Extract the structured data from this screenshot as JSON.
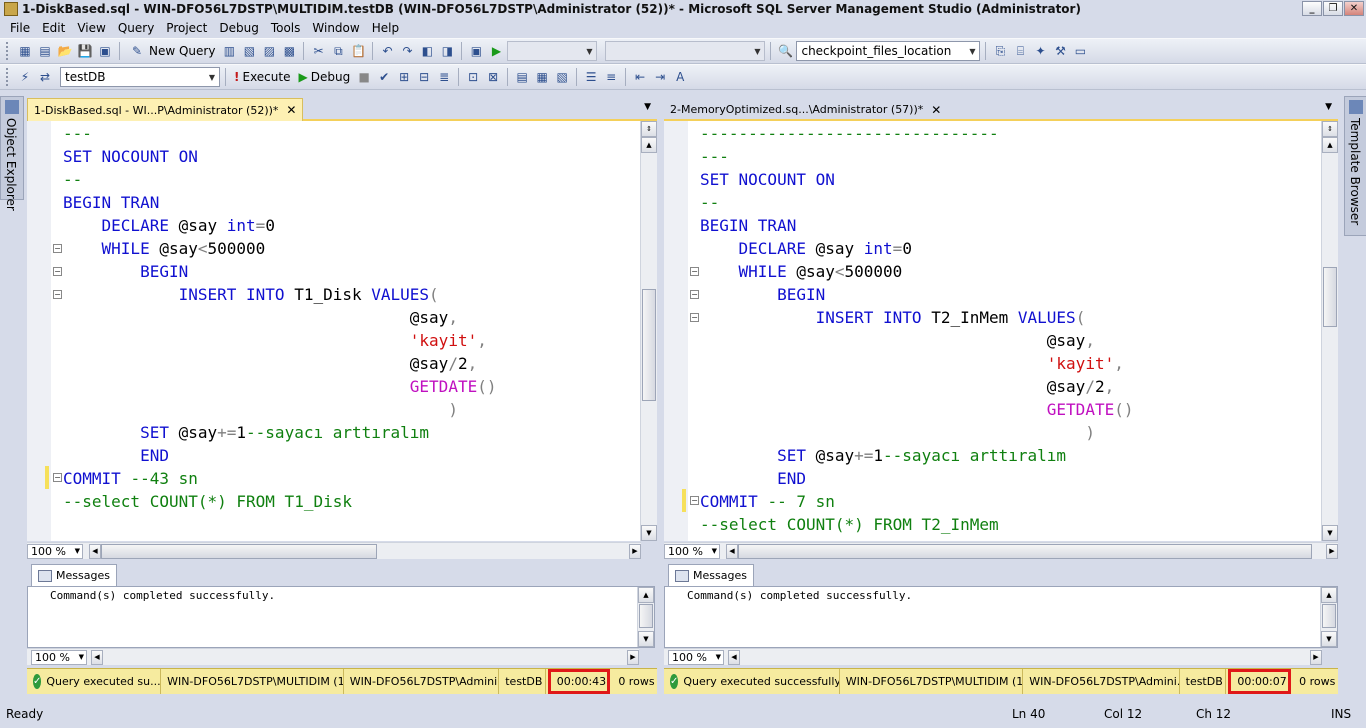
{
  "window": {
    "title": "1-DiskBased.sql - WIN-DFO56L7DSTP\\MULTIDIM.testDB (WIN-DFO56L7DSTP\\Administrator (52))* - Microsoft SQL Server Management Studio (Administrator)"
  },
  "menu": [
    "File",
    "Edit",
    "View",
    "Query",
    "Project",
    "Debug",
    "Tools",
    "Window",
    "Help"
  ],
  "toolbar1": {
    "new_query": "New Query",
    "find_value": "checkpoint_files_location"
  },
  "toolbar2": {
    "database": "testDB",
    "execute": "Execute",
    "debug": "Debug"
  },
  "side": {
    "left": "Object Explorer",
    "right": "Template Browser"
  },
  "left_pane": {
    "tab": "1-DiskBased.sql - WI...P\\Administrator (52))*",
    "zoom": "100 %",
    "messages_tab": "Messages",
    "message": "Command(s) completed successfully.",
    "msg_zoom": "100 %",
    "status": {
      "text": "Query executed su...",
      "server": "WIN-DFO56L7DSTP\\MULTIDIM (1...",
      "user": "WIN-DFO56L7DSTP\\Admini...",
      "db": "testDB",
      "time": "00:00:43",
      "rows": "0 rows"
    }
  },
  "right_pane": {
    "tab": "2-MemoryOptimized.sq...\\Administrator (57))*",
    "zoom": "100 %",
    "messages_tab": "Messages",
    "message": "Command(s) completed successfully.",
    "msg_zoom": "100 %",
    "status": {
      "text": "Query executed successfully.",
      "server": "WIN-DFO56L7DSTP\\MULTIDIM (1...",
      "user": "WIN-DFO56L7DSTP\\Admini...",
      "db": "testDB",
      "time": "00:00:07",
      "rows": "0 rows"
    }
  },
  "bottom_status": {
    "ready": "Ready",
    "ln": "Ln 40",
    "col": "Col 12",
    "ch": "Ch 12",
    "ins": "INS"
  },
  "code_left": [
    [
      [
        "cm",
        "---"
      ]
    ],
    [
      [
        "kw",
        "SET NOCOUNT ON"
      ]
    ],
    [
      [
        "cm",
        "--"
      ]
    ],
    [
      [
        "kw",
        "BEGIN TRAN"
      ]
    ],
    [
      [
        "",
        "    "
      ],
      [
        "kw",
        "DECLARE "
      ],
      [
        "",
        "@say "
      ],
      [
        "kw",
        "int"
      ],
      [
        "op",
        "="
      ],
      [
        "",
        "0"
      ]
    ],
    [
      [
        "",
        "    "
      ],
      [
        "kw",
        "WHILE "
      ],
      [
        "",
        "@say"
      ],
      [
        "op",
        "<"
      ],
      [
        "",
        "500000"
      ]
    ],
    [
      [
        "",
        "        "
      ],
      [
        "kw",
        "BEGIN"
      ]
    ],
    [
      [
        "",
        "            "
      ],
      [
        "kw",
        "INSERT INTO "
      ],
      [
        "",
        "T1_Disk "
      ],
      [
        "kw",
        "VALUES"
      ],
      [
        "op",
        "("
      ]
    ],
    [
      [
        "",
        "                                    @say"
      ],
      [
        "op",
        ","
      ]
    ],
    [
      [
        "",
        "                                    "
      ],
      [
        "st",
        "'kayit'"
      ],
      [
        "op",
        ","
      ]
    ],
    [
      [
        "",
        "                                    @say"
      ],
      [
        "op",
        "/"
      ],
      [
        "",
        "2"
      ],
      [
        "op",
        ","
      ]
    ],
    [
      [
        "",
        "                                    "
      ],
      [
        "fn",
        "GETDATE"
      ],
      [
        "op",
        "()"
      ]
    ],
    [
      [
        "",
        "                                        "
      ],
      [
        "op",
        ")"
      ]
    ],
    [
      [
        "",
        "        "
      ],
      [
        "kw",
        "SET "
      ],
      [
        "",
        "@say"
      ],
      [
        "op",
        "+="
      ],
      [
        "",
        "1"
      ],
      [
        "cm",
        "--sayacı arttıralım"
      ]
    ],
    [
      [
        "",
        "        "
      ],
      [
        "kw",
        "END"
      ]
    ],
    [
      [
        "kw",
        "COMMIT "
      ],
      [
        "cm",
        "--43 sn"
      ]
    ],
    [
      [
        "cm",
        "--select COUNT(*) FROM T1_Disk"
      ]
    ]
  ],
  "code_right": [
    [
      [
        "cm",
        "-------------------------------"
      ]
    ],
    [
      [
        "cm",
        "---"
      ]
    ],
    [
      [
        "kw",
        "SET NOCOUNT ON"
      ]
    ],
    [
      [
        "cm",
        "--"
      ]
    ],
    [
      [
        "kw",
        "BEGIN TRAN"
      ]
    ],
    [
      [
        "",
        "    "
      ],
      [
        "kw",
        "DECLARE "
      ],
      [
        "",
        "@say "
      ],
      [
        "kw",
        "int"
      ],
      [
        "op",
        "="
      ],
      [
        "",
        "0"
      ]
    ],
    [
      [
        "",
        "    "
      ],
      [
        "kw",
        "WHILE "
      ],
      [
        "",
        "@say"
      ],
      [
        "op",
        "<"
      ],
      [
        "",
        "500000"
      ]
    ],
    [
      [
        "",
        "        "
      ],
      [
        "kw",
        "BEGIN"
      ]
    ],
    [
      [
        "",
        "            "
      ],
      [
        "kw",
        "INSERT INTO "
      ],
      [
        "",
        "T2_InMem "
      ],
      [
        "kw",
        "VALUES"
      ],
      [
        "op",
        "("
      ]
    ],
    [
      [
        "",
        "                                    @say"
      ],
      [
        "op",
        ","
      ]
    ],
    [
      [
        "",
        "                                    "
      ],
      [
        "st",
        "'kayit'"
      ],
      [
        "op",
        ","
      ]
    ],
    [
      [
        "",
        "                                    @say"
      ],
      [
        "op",
        "/"
      ],
      [
        "",
        "2"
      ],
      [
        "op",
        ","
      ]
    ],
    [
      [
        "",
        "                                    "
      ],
      [
        "fn",
        "GETDATE"
      ],
      [
        "op",
        "()"
      ]
    ],
    [
      [
        "",
        "                                        "
      ],
      [
        "op",
        ")"
      ]
    ],
    [
      [
        "",
        "        "
      ],
      [
        "kw",
        "SET "
      ],
      [
        "",
        "@say"
      ],
      [
        "op",
        "+="
      ],
      [
        "",
        "1"
      ],
      [
        "cm",
        "--sayacı arttıralım"
      ]
    ],
    [
      [
        "",
        "        "
      ],
      [
        "kw",
        "END"
      ]
    ],
    [
      [
        "kw",
        "COMMIT "
      ],
      [
        "cm",
        "-- 7 sn"
      ]
    ],
    [
      [
        "cm",
        "--select COUNT(*) FROM T2_InMem"
      ]
    ]
  ]
}
